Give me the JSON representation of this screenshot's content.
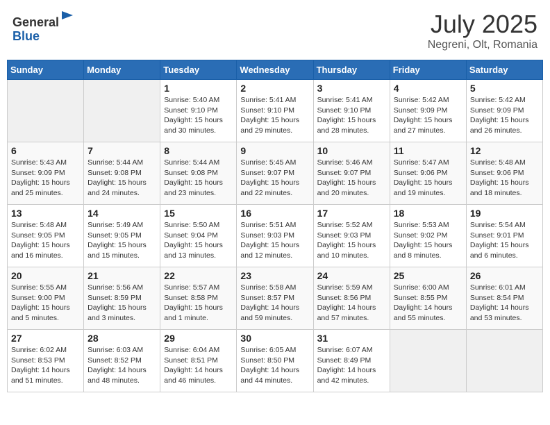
{
  "logo": {
    "general": "General",
    "blue": "Blue"
  },
  "title": "July 2025",
  "subtitle": "Negreni, Olt, Romania",
  "weekdays": [
    "Sunday",
    "Monday",
    "Tuesday",
    "Wednesday",
    "Thursday",
    "Friday",
    "Saturday"
  ],
  "weeks": [
    [
      {
        "day": "",
        "info": ""
      },
      {
        "day": "",
        "info": ""
      },
      {
        "day": "1",
        "info": "Sunrise: 5:40 AM\nSunset: 9:10 PM\nDaylight: 15 hours\nand 30 minutes."
      },
      {
        "day": "2",
        "info": "Sunrise: 5:41 AM\nSunset: 9:10 PM\nDaylight: 15 hours\nand 29 minutes."
      },
      {
        "day": "3",
        "info": "Sunrise: 5:41 AM\nSunset: 9:10 PM\nDaylight: 15 hours\nand 28 minutes."
      },
      {
        "day": "4",
        "info": "Sunrise: 5:42 AM\nSunset: 9:09 PM\nDaylight: 15 hours\nand 27 minutes."
      },
      {
        "day": "5",
        "info": "Sunrise: 5:42 AM\nSunset: 9:09 PM\nDaylight: 15 hours\nand 26 minutes."
      }
    ],
    [
      {
        "day": "6",
        "info": "Sunrise: 5:43 AM\nSunset: 9:09 PM\nDaylight: 15 hours\nand 25 minutes."
      },
      {
        "day": "7",
        "info": "Sunrise: 5:44 AM\nSunset: 9:08 PM\nDaylight: 15 hours\nand 24 minutes."
      },
      {
        "day": "8",
        "info": "Sunrise: 5:44 AM\nSunset: 9:08 PM\nDaylight: 15 hours\nand 23 minutes."
      },
      {
        "day": "9",
        "info": "Sunrise: 5:45 AM\nSunset: 9:07 PM\nDaylight: 15 hours\nand 22 minutes."
      },
      {
        "day": "10",
        "info": "Sunrise: 5:46 AM\nSunset: 9:07 PM\nDaylight: 15 hours\nand 20 minutes."
      },
      {
        "day": "11",
        "info": "Sunrise: 5:47 AM\nSunset: 9:06 PM\nDaylight: 15 hours\nand 19 minutes."
      },
      {
        "day": "12",
        "info": "Sunrise: 5:48 AM\nSunset: 9:06 PM\nDaylight: 15 hours\nand 18 minutes."
      }
    ],
    [
      {
        "day": "13",
        "info": "Sunrise: 5:48 AM\nSunset: 9:05 PM\nDaylight: 15 hours\nand 16 minutes."
      },
      {
        "day": "14",
        "info": "Sunrise: 5:49 AM\nSunset: 9:05 PM\nDaylight: 15 hours\nand 15 minutes."
      },
      {
        "day": "15",
        "info": "Sunrise: 5:50 AM\nSunset: 9:04 PM\nDaylight: 15 hours\nand 13 minutes."
      },
      {
        "day": "16",
        "info": "Sunrise: 5:51 AM\nSunset: 9:03 PM\nDaylight: 15 hours\nand 12 minutes."
      },
      {
        "day": "17",
        "info": "Sunrise: 5:52 AM\nSunset: 9:03 PM\nDaylight: 15 hours\nand 10 minutes."
      },
      {
        "day": "18",
        "info": "Sunrise: 5:53 AM\nSunset: 9:02 PM\nDaylight: 15 hours\nand 8 minutes."
      },
      {
        "day": "19",
        "info": "Sunrise: 5:54 AM\nSunset: 9:01 PM\nDaylight: 15 hours\nand 6 minutes."
      }
    ],
    [
      {
        "day": "20",
        "info": "Sunrise: 5:55 AM\nSunset: 9:00 PM\nDaylight: 15 hours\nand 5 minutes."
      },
      {
        "day": "21",
        "info": "Sunrise: 5:56 AM\nSunset: 8:59 PM\nDaylight: 15 hours\nand 3 minutes."
      },
      {
        "day": "22",
        "info": "Sunrise: 5:57 AM\nSunset: 8:58 PM\nDaylight: 15 hours\nand 1 minute."
      },
      {
        "day": "23",
        "info": "Sunrise: 5:58 AM\nSunset: 8:57 PM\nDaylight: 14 hours\nand 59 minutes."
      },
      {
        "day": "24",
        "info": "Sunrise: 5:59 AM\nSunset: 8:56 PM\nDaylight: 14 hours\nand 57 minutes."
      },
      {
        "day": "25",
        "info": "Sunrise: 6:00 AM\nSunset: 8:55 PM\nDaylight: 14 hours\nand 55 minutes."
      },
      {
        "day": "26",
        "info": "Sunrise: 6:01 AM\nSunset: 8:54 PM\nDaylight: 14 hours\nand 53 minutes."
      }
    ],
    [
      {
        "day": "27",
        "info": "Sunrise: 6:02 AM\nSunset: 8:53 PM\nDaylight: 14 hours\nand 51 minutes."
      },
      {
        "day": "28",
        "info": "Sunrise: 6:03 AM\nSunset: 8:52 PM\nDaylight: 14 hours\nand 48 minutes."
      },
      {
        "day": "29",
        "info": "Sunrise: 6:04 AM\nSunset: 8:51 PM\nDaylight: 14 hours\nand 46 minutes."
      },
      {
        "day": "30",
        "info": "Sunrise: 6:05 AM\nSunset: 8:50 PM\nDaylight: 14 hours\nand 44 minutes."
      },
      {
        "day": "31",
        "info": "Sunrise: 6:07 AM\nSunset: 8:49 PM\nDaylight: 14 hours\nand 42 minutes."
      },
      {
        "day": "",
        "info": ""
      },
      {
        "day": "",
        "info": ""
      }
    ]
  ]
}
